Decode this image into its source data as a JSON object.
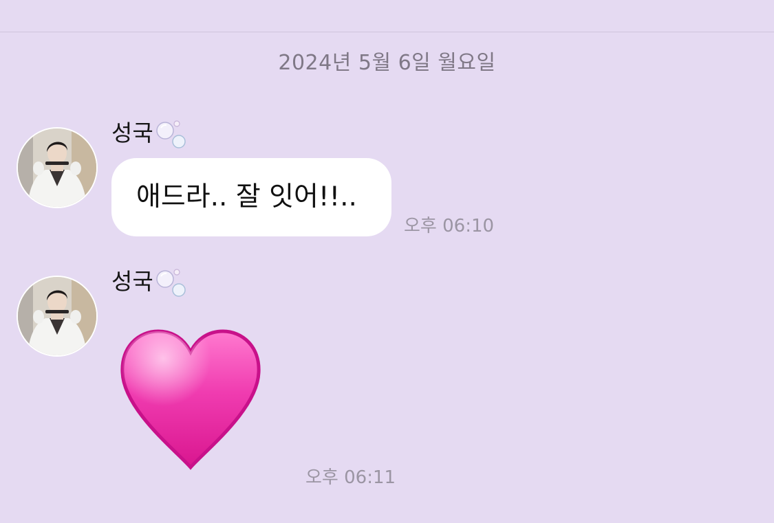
{
  "chat": {
    "date_separator": "2024년 5월 6일 월요일",
    "messages": [
      {
        "sender": "성국",
        "text": "애드라.. 잘 잇어!!..",
        "time": "오후 06:10"
      },
      {
        "sender": "성국",
        "emoji": "heart-pink",
        "time": "오후 06:11"
      }
    ]
  },
  "colors": {
    "background": "#e5daf2",
    "bubble": "#ffffff",
    "heart": "#ee2fa6"
  }
}
